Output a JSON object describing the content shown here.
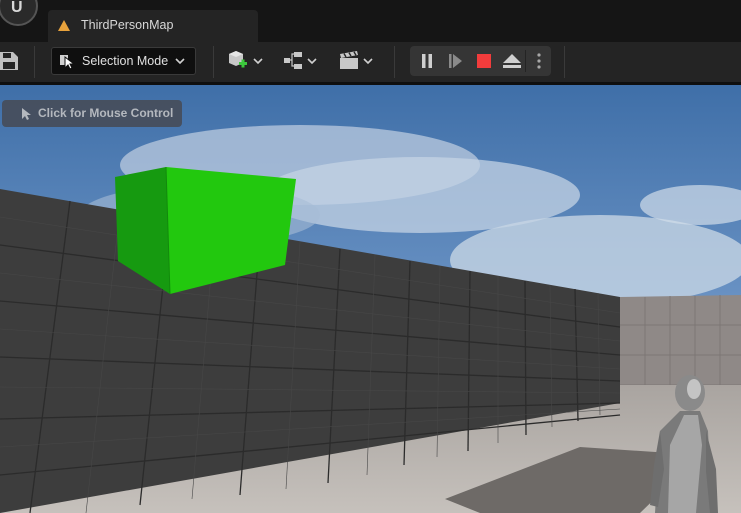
{
  "app": {
    "logo_text": "U"
  },
  "tabs": [
    {
      "label": "ThirdPersonMap",
      "icon": "level-map-icon"
    }
  ],
  "toolbar": {
    "save_icon": "save-icon",
    "mode_label": "Selection Mode",
    "add_icon": "add-actor-icon",
    "blueprint_icon": "blueprint-icon",
    "cinematics_icon": "clapperboard-icon",
    "play_controls": [
      "pause-icon",
      "step-frame-icon",
      "stop-icon",
      "eject-icon",
      "more-options-icon"
    ]
  },
  "viewport": {
    "mouse_control_label": "Click for Mouse Control",
    "colors": {
      "sky": "#5b86be",
      "wall": "#3c3c3c",
      "cube": "#22c80e",
      "floor": "#b8b2ac"
    }
  }
}
